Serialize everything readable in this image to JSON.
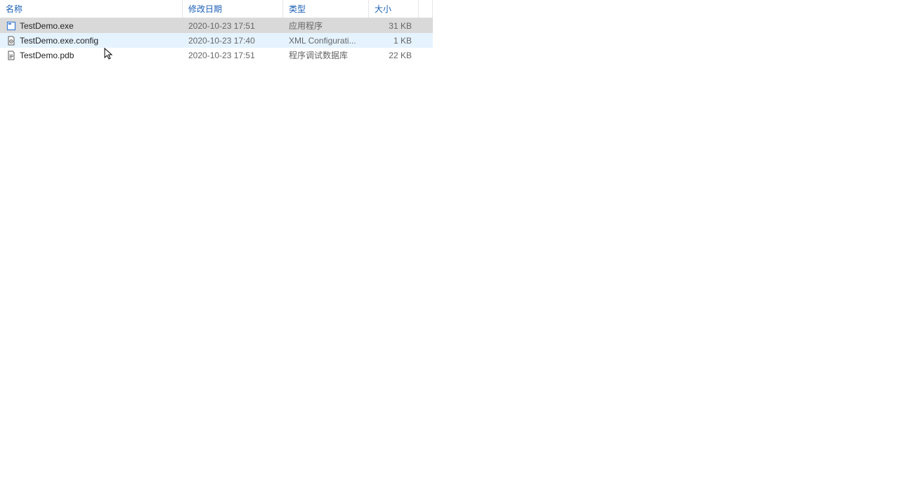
{
  "columns": {
    "name": "名称",
    "date": "修改日期",
    "type": "类型",
    "size": "大小"
  },
  "files": [
    {
      "icon": "exe-file-icon",
      "name": "TestDemo.exe",
      "date": "2020-10-23 17:51",
      "type": "应用程序",
      "size": "31 KB",
      "state": "selected"
    },
    {
      "icon": "config-file-icon",
      "name": "TestDemo.exe.config",
      "date": "2020-10-23 17:40",
      "type": "XML Configurati...",
      "size": "1 KB",
      "state": "hover"
    },
    {
      "icon": "pdb-file-icon",
      "name": "TestDemo.pdb",
      "date": "2020-10-23 17:51",
      "type": "程序调试数据库",
      "size": "22 KB",
      "state": ""
    }
  ]
}
